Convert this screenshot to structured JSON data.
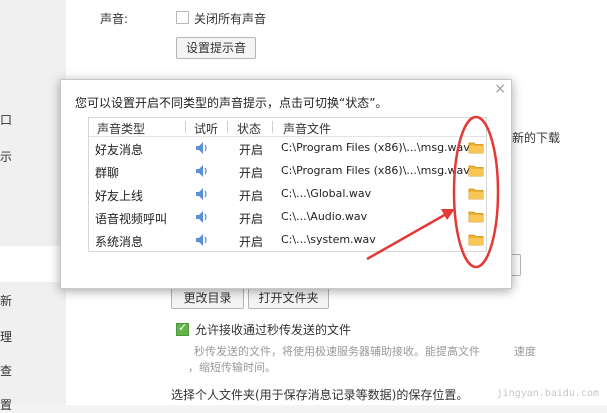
{
  "left_strip": {
    "chars": [
      "口",
      "示",
      "新",
      "理",
      "查",
      "置"
    ]
  },
  "background": {
    "sound_label": "声音:",
    "mute_all_label": "关闭所有声音",
    "set_sound_button": "设置提示音",
    "partial_right_text": "新的下载",
    "change_dir_button": "更改目录",
    "open_folder_button": "打开文件夹",
    "allow_receive_label": "允许接收通过秒传发送的文件",
    "hint_line1": "秒传发送的文件，将使用极速服务器辅助接收。能提高文件",
    "hint_line1_end": "速度",
    "hint_line2": "，缩短传输时间。",
    "personal_folder_text": "选择个人文件夹(用于保存消息记录等数据)的保存位置。",
    "watermark": "jingyan.baidu.com"
  },
  "dialog": {
    "close_glyph": "×",
    "message": "您可以设置开启不同类型的声音提示，点击可切换“状态”。",
    "columns": {
      "type": "声音类型",
      "listen": "试听",
      "status": "状态",
      "file": "声音文件"
    },
    "rows": [
      {
        "type": "好友消息",
        "status": "开启",
        "file": "C:\\Program Files (x86)\\...\\msg.wav"
      },
      {
        "type": "群聊",
        "status": "开启",
        "file": "C:\\Program Files (x86)\\...\\msg.wav"
      },
      {
        "type": "好友上线",
        "status": "开启",
        "file": "C:\\...\\Global.wav"
      },
      {
        "type": "语音视频呼叫",
        "status": "开启",
        "file": "C:\\...\\Audio.wav"
      },
      {
        "type": "系统消息",
        "status": "开启",
        "file": "C:\\...\\system.wav"
      }
    ]
  },
  "colors": {
    "folder": "#f2b233",
    "annotation": "#e53935",
    "speaker": "#5b8fd6",
    "checkbox_checked": "#63b34a"
  },
  "icons": [
    "speaker-icon",
    "folder-icon",
    "close-icon",
    "checkbox-icon"
  ]
}
